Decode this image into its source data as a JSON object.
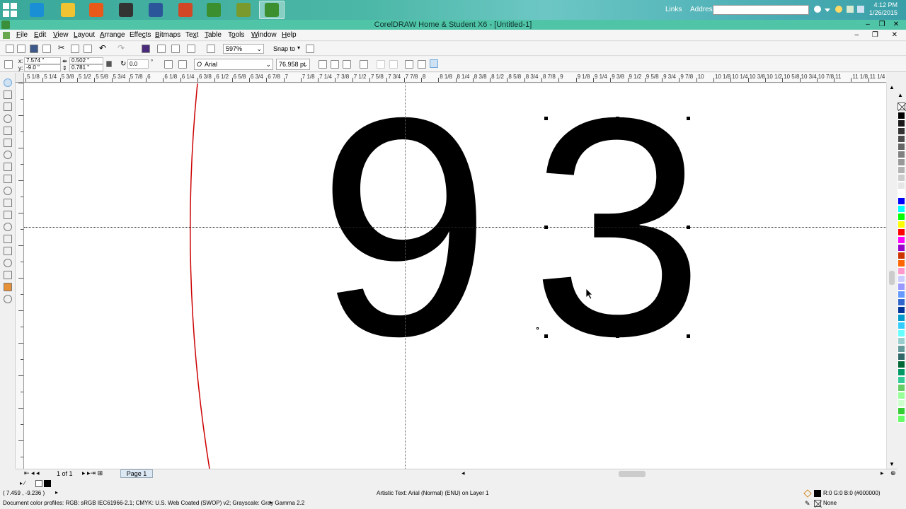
{
  "taskbar": {
    "links_label": "Links",
    "address_label": "Address",
    "clock_time": "4:12 PM",
    "clock_date": "1/26/2015",
    "apps": [
      {
        "name": "internet-explorer-icon",
        "color": "#1b8fd6"
      },
      {
        "name": "file-explorer-icon",
        "color": "#f1c232"
      },
      {
        "name": "firefox-icon",
        "color": "#e8591a"
      },
      {
        "name": "movie-clapper-icon",
        "color": "#333333"
      },
      {
        "name": "word-icon",
        "color": "#2b579a"
      },
      {
        "name": "powerpoint-icon",
        "color": "#d24726"
      },
      {
        "name": "coreldraw-icon",
        "color": "#3b8f2e"
      },
      {
        "name": "corel-pen-icon",
        "color": "#7a9a2e"
      },
      {
        "name": "coreldraw-active-icon",
        "color": "#3b8f2e"
      }
    ]
  },
  "window": {
    "title": "CorelDRAW Home & Student X6 - [Untitled-1]",
    "minimize": "–",
    "restore": "❐",
    "close": "✕"
  },
  "menu": {
    "items": [
      {
        "pre": "",
        "key": "F",
        "post": "ile"
      },
      {
        "pre": "",
        "key": "E",
        "post": "dit"
      },
      {
        "pre": "",
        "key": "V",
        "post": "iew"
      },
      {
        "pre": "",
        "key": "L",
        "post": "ayout"
      },
      {
        "pre": "",
        "key": "A",
        "post": "rrange"
      },
      {
        "pre": "Effe",
        "key": "c",
        "post": "ts"
      },
      {
        "pre": "",
        "key": "B",
        "post": "itmaps"
      },
      {
        "pre": "Te",
        "key": "x",
        "post": "t"
      },
      {
        "pre": "",
        "key": "T",
        "post": "able"
      },
      {
        "pre": "T",
        "key": "o",
        "post": "ols"
      },
      {
        "pre": "",
        "key": "W",
        "post": "indow"
      },
      {
        "pre": "",
        "key": "H",
        "post": "elp"
      }
    ],
    "controls": "– ❐ ✕"
  },
  "toolbar": {
    "zoom": "597%",
    "snap_to": "Snap to"
  },
  "property_bar": {
    "x": "7.574 \"",
    "y": "-9.0 \"",
    "width": "0.502 \"",
    "height": "0.781 \"",
    "rotation": "0.0",
    "rotation_unit": "°",
    "font": "Arial",
    "font_size": "76.958 pt"
  },
  "rulers": {
    "top_labels": [
      "5 1/8",
      "5 1/4",
      "5 3/8",
      "5 1/2",
      "5 5/8",
      "5 3/4",
      "5 7/8",
      "6",
      "6 1/8",
      "6 1/4",
      "6 3/8",
      "6 1/2",
      "6 5/8",
      "6 3/4",
      "6 7/8",
      "7",
      "7 1/8",
      "7 1/4",
      "7 3/8",
      "7 1/2",
      "7 5/8",
      "7 3/4",
      "7 7/8",
      "8",
      "8 1/8",
      "8 1/4",
      "8 3/8",
      "8 1/2",
      "8 5/8",
      "8 3/4",
      "8 7/8",
      "9",
      "9 1/8",
      "9 1/4",
      "9 3/8",
      "9 1/2",
      "9 5/8",
      "9 3/4",
      "9 7/8",
      "10",
      "10 1/8",
      "10 1/4",
      "10 3/8",
      "10 1/2",
      "10 5/8",
      "10 3/4",
      "10 7/8",
      "11",
      "11 1/8",
      "11 1/4"
    ],
    "unit_label": "inches"
  },
  "canvas": {
    "text_left": "9",
    "text_right": "3"
  },
  "palette": [
    "#000000",
    "#1a1a1a",
    "#333333",
    "#4d4d4d",
    "#666666",
    "#808080",
    "#999999",
    "#b3b3b3",
    "#cccccc",
    "#e6e6e6",
    "#ffffff",
    "#0000ff",
    "#00ffff",
    "#00ff00",
    "#ffff00",
    "#ff0000",
    "#ff00ff",
    "#9900cc",
    "#cc3300",
    "#ff6600",
    "#ff99cc",
    "#ccccff",
    "#9999ff",
    "#6699ff",
    "#3366cc",
    "#003399",
    "#0099cc",
    "#33ccff",
    "#66ffff",
    "#99cccc",
    "#669999",
    "#336666",
    "#006633",
    "#009966",
    "#33cc99",
    "#66cc66",
    "#99ff99",
    "#ccffcc",
    "#33cc33",
    "#66ff66"
  ],
  "page_nav": {
    "count": "1 of 1",
    "page_tab": "Page 1"
  },
  "status": {
    "coords": "( 7.459 , -9.236 )",
    "object_info": "Artistic Text: Arial (Normal) (ENU) on Layer 1",
    "fill_info": "R:0 G:0 B:0 (#000000)",
    "outline_info": "None",
    "color_profiles": "Document color profiles: RGB: sRGB IEC61966-2.1; CMYK: U.S. Web Coated (SWOP) v2; Grayscale: Gray Gamma 2.2"
  }
}
